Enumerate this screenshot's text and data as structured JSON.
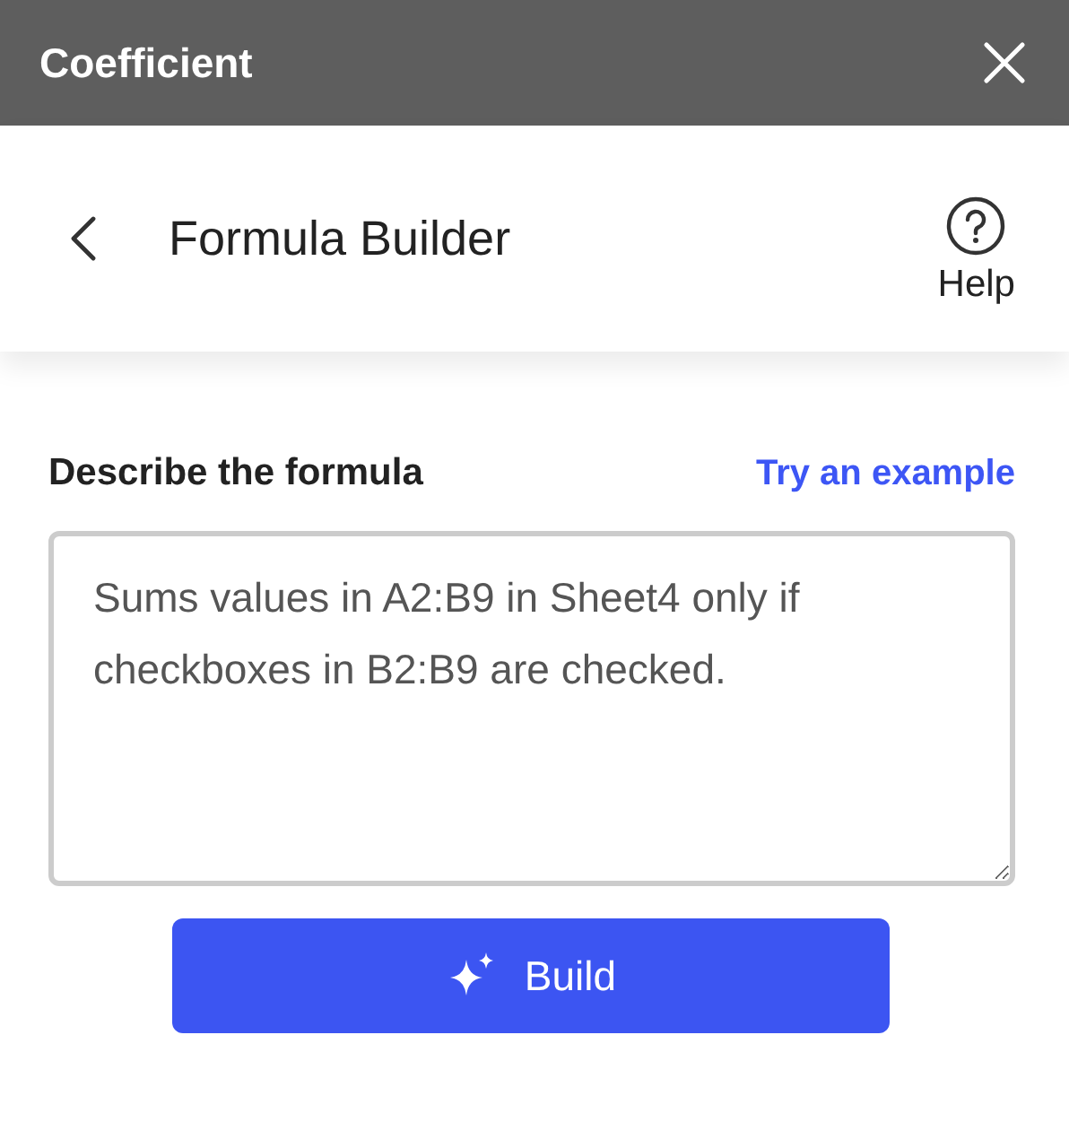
{
  "window": {
    "title": "Coefficient"
  },
  "header": {
    "title": "Formula Builder",
    "help": "Help"
  },
  "form": {
    "label": "Describe the formula",
    "example_link": "Try an example",
    "value": "Sums values in A2:B9 in Sheet4 only if checkboxes in B2:B9 are checked.",
    "button": "Build"
  }
}
